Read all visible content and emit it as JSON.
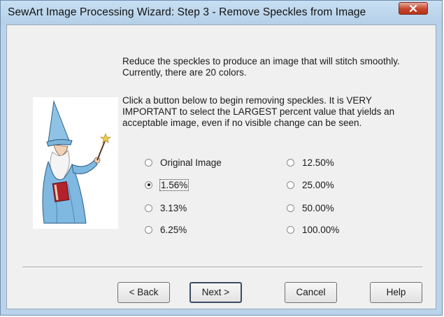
{
  "window": {
    "title": "SewArt Image Processing Wizard: Step 3 - Remove Speckles from Image"
  },
  "content": {
    "paragraph1": "Reduce the speckles to produce an image that will stitch smoothly. Currently, there are 20 colors.",
    "paragraph2": "Click a button below to begin removing speckles. It is VERY IMPORTANT to select the LARGEST percent value that yields an acceptable image, even if no visible change can be seen."
  },
  "options": {
    "selected": "1.56%",
    "left": [
      {
        "label": "Original Image",
        "checked": false
      },
      {
        "label": "1.56%",
        "checked": true
      },
      {
        "label": "3.13%",
        "checked": false
      },
      {
        "label": "6.25%",
        "checked": false
      }
    ],
    "right": [
      {
        "label": "12.50%",
        "checked": false
      },
      {
        "label": "25.00%",
        "checked": false
      },
      {
        "label": "50.00%",
        "checked": false
      },
      {
        "label": "100.00%",
        "checked": false
      }
    ]
  },
  "buttons": {
    "back": "< Back",
    "next": "Next >",
    "cancel": "Cancel",
    "help": "Help"
  },
  "icons": {
    "close": "close-icon",
    "wizard": "wizard-illustration"
  }
}
